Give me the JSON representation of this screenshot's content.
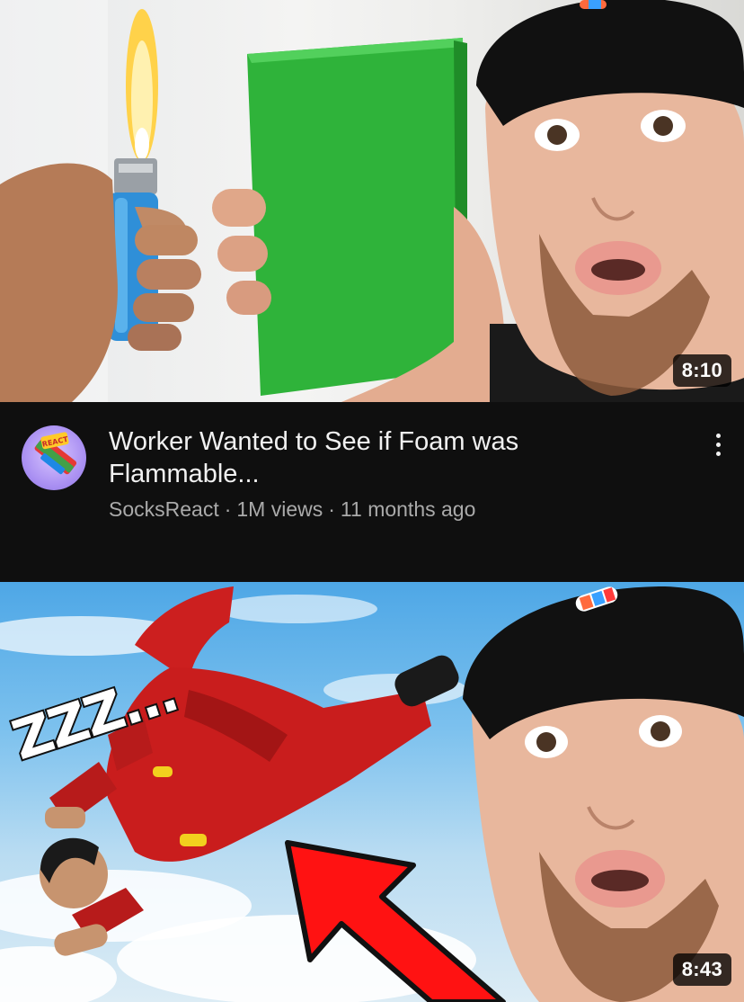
{
  "feed": {
    "videos": [
      {
        "duration": "8:10",
        "title": "Worker Wanted to See if Foam was Flammable...",
        "channel": "SocksReact",
        "views": "1M views",
        "age": "11 months ago",
        "separator": "·",
        "avatar_text": "REACT"
      },
      {
        "duration": "8:43",
        "thumbnail_text": "ZZZ..."
      }
    ]
  },
  "colors": {
    "background": "#0f0f0f",
    "title_text": "#f1f1f1",
    "subtitle_text": "#aaaaaa",
    "foam_green": "#2fb33a",
    "arrow_red": "#ff1212"
  },
  "icons": {
    "more_options": "more-vert-icon"
  }
}
